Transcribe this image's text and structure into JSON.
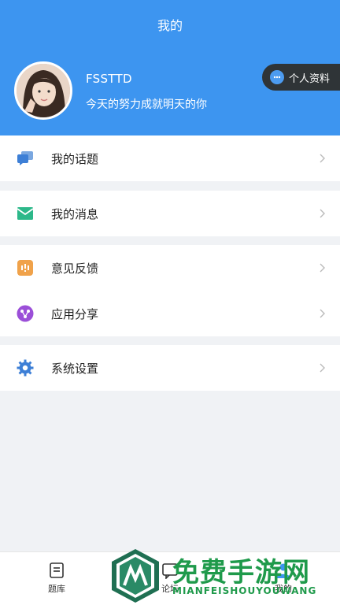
{
  "header": {
    "title": "我的",
    "username": "FSSTTD",
    "bio": "今天的努力成就明天的你",
    "profile_button": "个人资料",
    "bg_color": "#3d95f0"
  },
  "menu": {
    "topics": "我的话题",
    "messages": "我的消息",
    "feedback": "意见反馈",
    "share": "应用分享",
    "settings": "系统设置"
  },
  "tabs": {
    "questions": "题库",
    "forum": "论坛",
    "mine": "我的"
  },
  "watermark": {
    "title": "免费手游网",
    "subtitle": "MIANFEISHOUYOUWANG"
  }
}
